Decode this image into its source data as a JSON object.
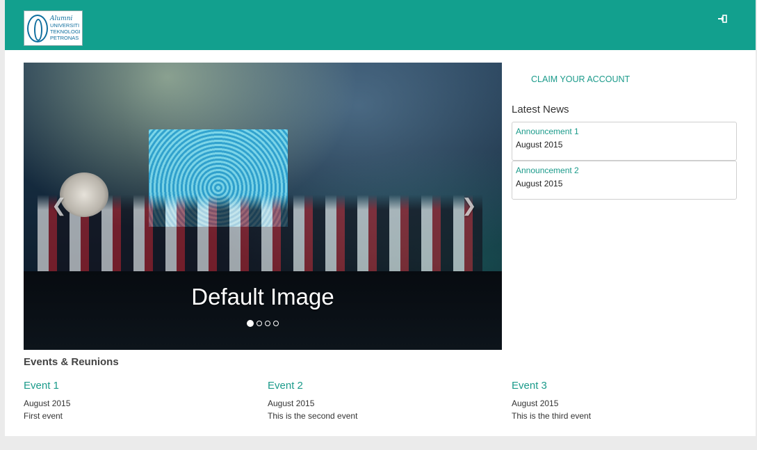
{
  "header": {
    "logo_lines": [
      "Alumni",
      "UNIVERSITI",
      "TEKNOLOGI",
      "PETRONAS"
    ],
    "login_icon": "sign-in-icon"
  },
  "carousel": {
    "caption": "Default Image",
    "slide_count": 4,
    "active_index": 0,
    "prev_icon": "chevron-left-icon",
    "next_icon": "chevron-right-icon"
  },
  "sidebar": {
    "claim_link": "CLAIM YOUR ACCOUNT",
    "news_title": "Latest News",
    "news": [
      {
        "title": "Announcement 1",
        "date": "August 2015"
      },
      {
        "title": "Announcement 2",
        "date": "August 2015"
      }
    ]
  },
  "events": {
    "title": "Events & Reunions",
    "items": [
      {
        "title": "Event 1",
        "date": "August 2015",
        "desc": "First event"
      },
      {
        "title": "Event 2",
        "date": "August 2015",
        "desc": "This is the second event"
      },
      {
        "title": "Event 3",
        "date": "August 2015",
        "desc": "This is the third event"
      }
    ]
  },
  "colors": {
    "brand": "#12a08e",
    "link": "#1a9a8a",
    "page_bg": "#ebebeb"
  }
}
